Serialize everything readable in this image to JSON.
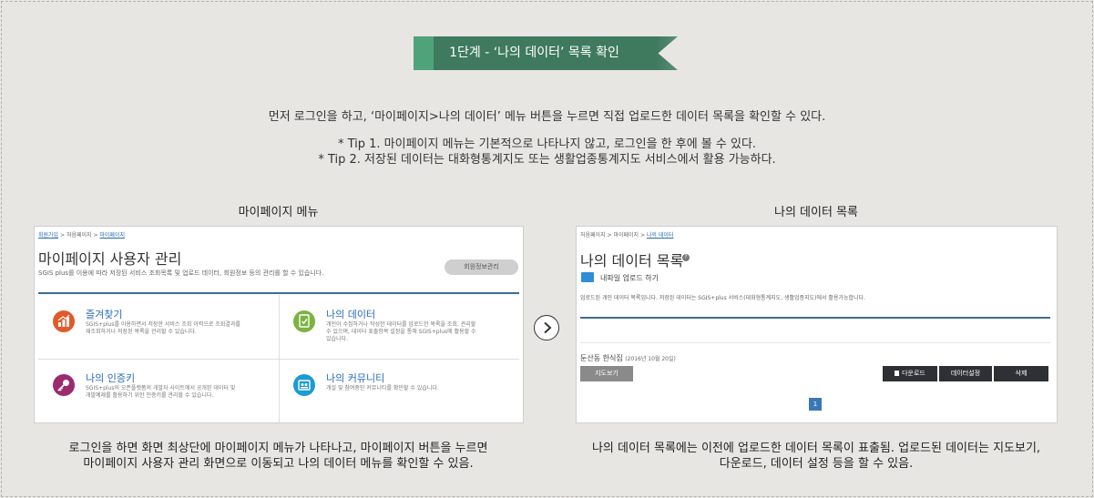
{
  "banner": {
    "title": "1단계 - ‘나의 데이터’ 목록 확인"
  },
  "intro": "먼저 로그인을 하고, ‘마이페이지>나의 데이터’ 메뉴 버튼을 누르면 직접 업로드한 데이터 목록을 확인할 수 있다.",
  "tips": [
    "* Tip 1. 마이페이지 메뉴는 기본적으로 나타나지 않고, 로그인을 한 후에 볼 수 있다.",
    "* Tip 2. 저장된 데이터는 대화형통계지도 또는 생활업종통계지도 서비스에서 활용 가능하다."
  ],
  "left": {
    "caption": "마이페이지 메뉴",
    "breadcrumb": {
      "home": "회원가입",
      "sep1": " > ",
      "first": "처음페이지",
      "sep2": " > ",
      "current": "마이페이지"
    },
    "title": "마이페이지 사용자 관리",
    "subtitle": "SGIS plus를 이용에 따라 저장된 서비스 조회목록 및 업로드 데이터, 회원정보 등의 관리를 할 수 있습니다.",
    "profile_button": "회원정보관리",
    "cards": [
      {
        "title": "즐겨찾기",
        "desc": "SGIS+plus를 이용하면서 저장한 서비스 조회 이력으로 조회결과를 재조회하거나 저장된 목록을 관리할 수 있습니다.",
        "color": "#e05a2b",
        "icon": "chart-icon"
      },
      {
        "title": "나의 데이터",
        "desc": "개인이 수집하거나 작성한 데이터를 업로드한 목록을 조회, 관리할 수 있으며, 데이터 표출항목 설정을 통해 SGIS+plus에 활용할 수 있습니다.",
        "color": "#7cb342",
        "icon": "data-icon"
      },
      {
        "title": "나의 인증키",
        "desc": "SGIS+plus의 오픈플랫폼의 개발자 사이트에서 공개된 데이터 및 개발예제를 활용하기 위한 인증키를 관리할 수 있습니다.",
        "color": "#9c2a6e",
        "icon": "key-icon"
      },
      {
        "title": "나의 커뮤니티",
        "desc": "개설 및 참여중인 커뮤니티를 확인할 수 있습니다.",
        "color": "#1e9ad6",
        "icon": "community-icon"
      }
    ],
    "footer": [
      "로그인을 하면 화면 최상단에 마이페이지 메뉴가 나타나고, 마이페이지 버튼을 누르면",
      "마이페이지 사용자 관리 화면으로 이동되고 나의 데이터 메뉴를 확인할 수 있음."
    ]
  },
  "right": {
    "caption": "나의 데이터 목록",
    "breadcrumb": {
      "home": "처음페이지",
      "sep1": " > ",
      "first": "마이페이지",
      "sep2": " > ",
      "current": "나의 데이터"
    },
    "title": "나의 데이터 목록",
    "help": "?",
    "upload_label": "내파일 업로드 하기",
    "desc": "업로드된 개인 데이터 목록입니다. 저장된 데이터는 SGIS+plus 서비스(대화형통계지도, 생활업종지도)에서 활용가능합니다.",
    "item_name": "둔산동 한식집",
    "item_date": "(2016년 10월 20일)",
    "map_button": "지도보기",
    "download_button": "다운로드",
    "settings_button": "데이터설정",
    "delete_button": "삭제",
    "page": "1",
    "footer": [
      "나의 데이터 목록에는 이전에 업로드한 데이터 목록이 표출됨. 업로드된 데이터는 지도보기,",
      "다운로드, 데이터 설정 등을 할 수 있음."
    ]
  }
}
